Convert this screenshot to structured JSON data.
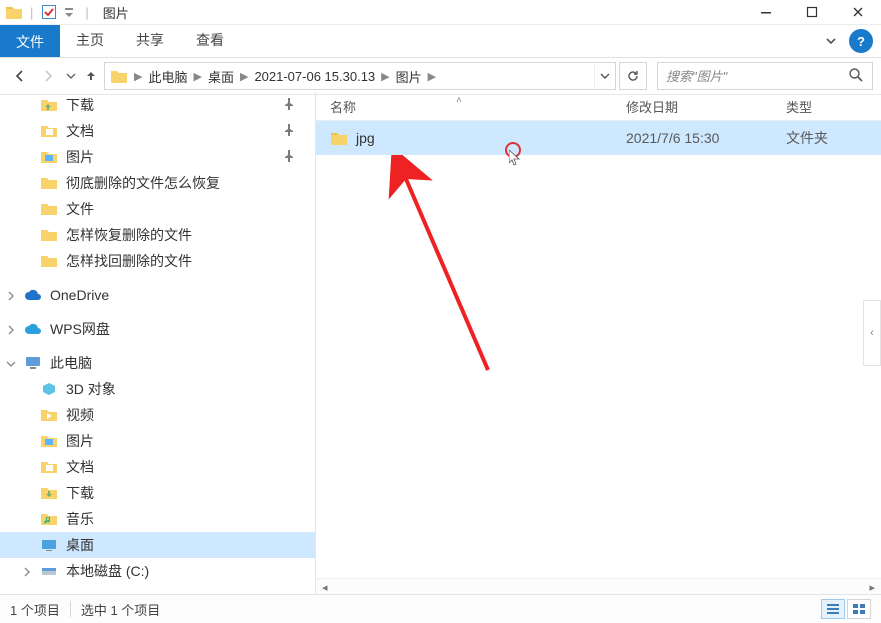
{
  "window": {
    "title": "图片"
  },
  "ribbon": {
    "file_tab": "文件",
    "tabs": [
      "主页",
      "共享",
      "查看"
    ]
  },
  "breadcrumb": {
    "items": [
      "此电脑",
      "桌面",
      "2021-07-06 15.30.13",
      "图片"
    ]
  },
  "search": {
    "placeholder": "搜索\"图片\""
  },
  "columns": {
    "name": "名称",
    "date": "修改日期",
    "type": "类型"
  },
  "rows": [
    {
      "name": "jpg",
      "date": "2021/7/6 15:30",
      "type": "文件夹",
      "selected": true
    }
  ],
  "nav": {
    "quick": [
      {
        "label": "下载",
        "pinned": true
      },
      {
        "label": "文档",
        "pinned": true
      },
      {
        "label": "图片",
        "pinned": true
      },
      {
        "label": "彻底删除的文件怎么恢复",
        "pinned": false
      },
      {
        "label": "文件",
        "pinned": false
      },
      {
        "label": "怎样恢复删除的文件",
        "pinned": false
      },
      {
        "label": "怎样找回删除的文件",
        "pinned": false
      }
    ],
    "onedrive": "OneDrive",
    "wps": "WPS网盘",
    "thispc": {
      "label": "此电脑",
      "children": [
        "3D 对象",
        "视频",
        "图片",
        "文档",
        "下载",
        "音乐",
        "桌面",
        "本地磁盘 (C:)"
      ]
    }
  },
  "status": {
    "count": "1 个项目",
    "selected": "选中 1 个项目"
  }
}
